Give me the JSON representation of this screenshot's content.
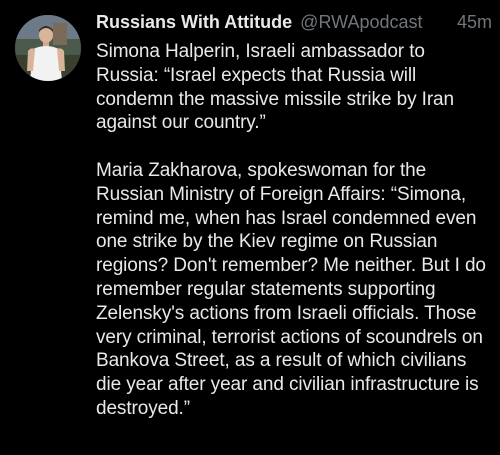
{
  "post": {
    "author": {
      "display_name": "Russians With Attitude",
      "handle": "@RWApodcast",
      "avatar_icon": "user-avatar"
    },
    "timestamp": "45m",
    "paragraphs": [
      "Simona Halperin, Israeli ambassador to Russia: “Israel expects that Russia will condemn the massive missile strike by Iran against our country.”",
      "Maria Zakharova, spokeswoman for the Russian Ministry of Foreign Affairs: “Simona, remind me, when has Israel condemned even one strike by the Kiev regime on Russian regions? Don't remember? Me neither. But I do remember regular statements supporting Zelensky's actions from Israeli officials. Those very criminal, terrorist actions of scoundrels on Bankova Street, as a result of which civilians die year after year and civilian infrastructure is destroyed.”"
    ]
  },
  "colors": {
    "background": "#000000",
    "primary_text": "#e7e9ea",
    "secondary_text": "#71767b"
  }
}
